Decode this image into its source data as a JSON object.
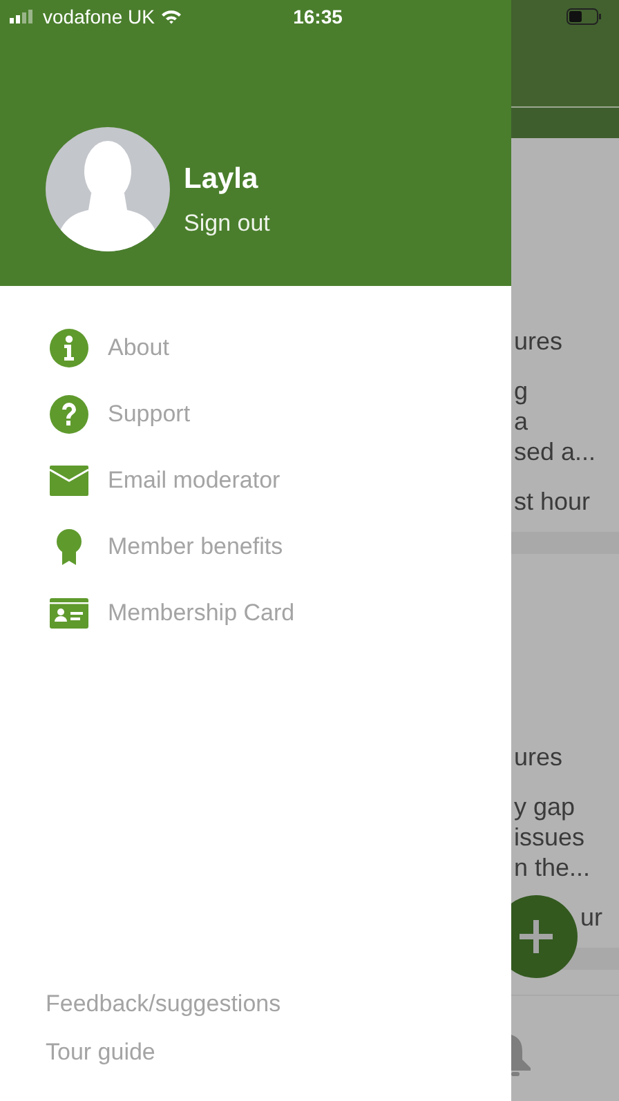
{
  "status_bar": {
    "carrier": "vodafone UK",
    "time": "16:35"
  },
  "drawer": {
    "user": {
      "name": "Layla",
      "sign_out": "Sign out"
    },
    "menu": [
      {
        "label": "About",
        "kind": "info"
      },
      {
        "label": "Support",
        "kind": "help"
      },
      {
        "label": "Email moderator",
        "kind": "email"
      },
      {
        "label": "Member benefits",
        "kind": "benefits"
      },
      {
        "label": "Membership Card",
        "kind": "card"
      }
    ],
    "footer_links": [
      "Feedback/suggestions",
      "Tour guide"
    ]
  },
  "background_feed": [
    {
      "title": "ures",
      "excerpt": [
        "g",
        "a",
        "sed a..."
      ],
      "time": "st hour"
    },
    {
      "title": "ures",
      "excerpt": [
        "y gap",
        "issues",
        "n the..."
      ],
      "time": "ur"
    }
  ]
}
